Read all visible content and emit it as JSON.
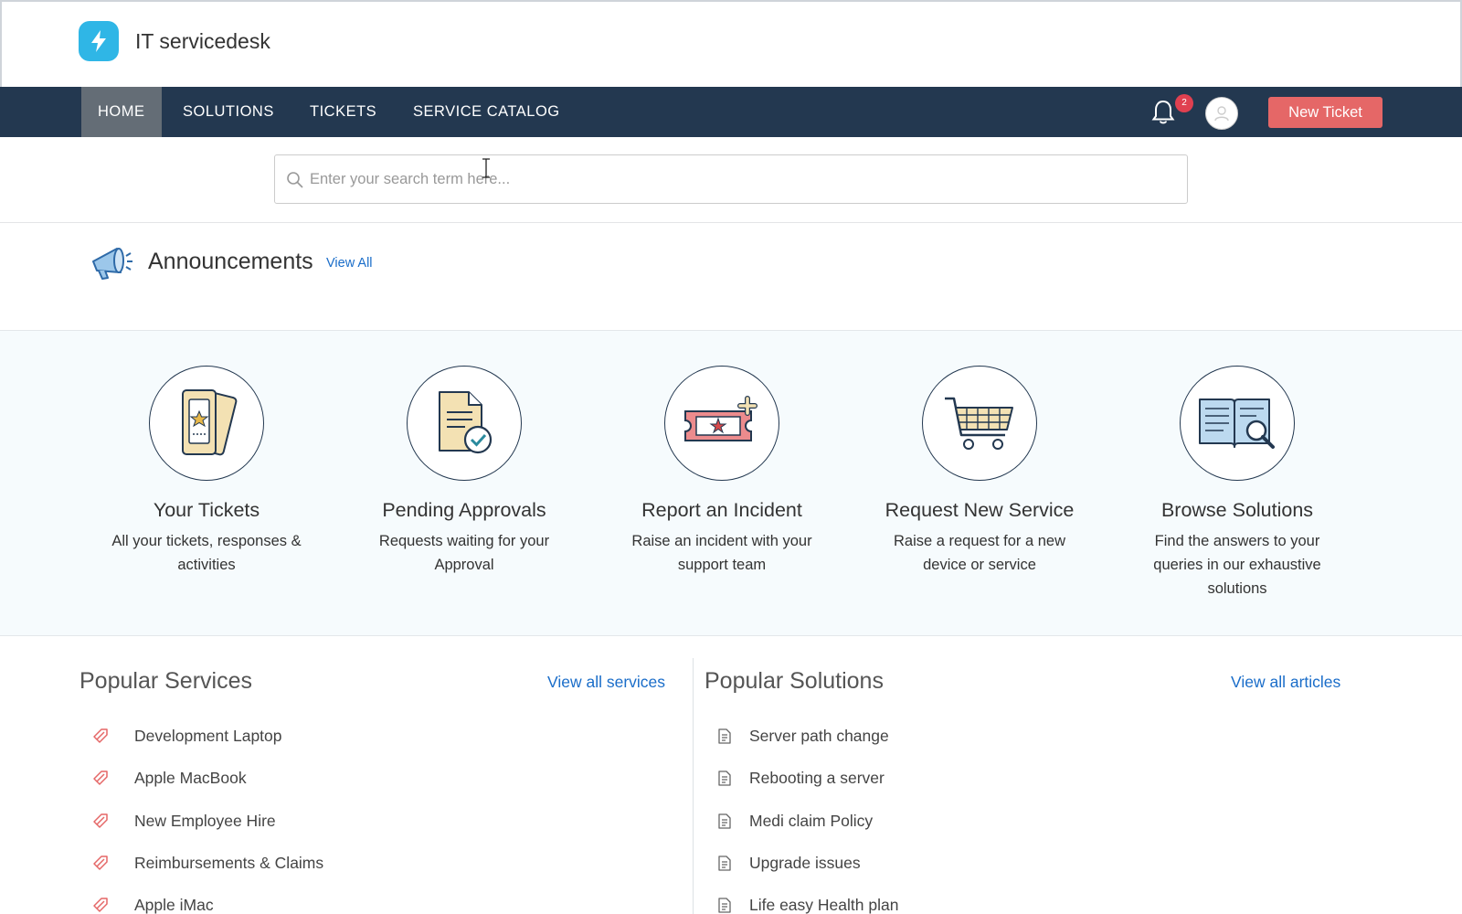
{
  "app": {
    "title": "IT servicedesk",
    "logo_icon": "lightning-bolt-icon"
  },
  "nav": {
    "items": [
      {
        "label": "HOME",
        "active": true
      },
      {
        "label": "SOLUTIONS",
        "active": false
      },
      {
        "label": "TICKETS",
        "active": false
      },
      {
        "label": "SERVICE CATALOG",
        "active": false
      }
    ],
    "notifications_count": "2",
    "new_ticket_label": "New Ticket"
  },
  "search": {
    "placeholder": "Enter your search term here...",
    "value": ""
  },
  "announcements": {
    "title": "Announcements",
    "view_all": "View All"
  },
  "quick_actions": [
    {
      "title": "Your Tickets",
      "desc": "All your tickets, responses & activities",
      "icon": "tickets-icon"
    },
    {
      "title": "Pending Approvals",
      "desc": "Requests waiting for your Approval",
      "icon": "approval-document-icon"
    },
    {
      "title": "Report an Incident",
      "desc": "Raise an incident with your support team",
      "icon": "report-incident-icon"
    },
    {
      "title": "Request New Service",
      "desc": "Raise a request for a new device or service",
      "icon": "shopping-cart-icon"
    },
    {
      "title": "Browse Solutions",
      "desc": "Find the answers to your queries in our exhaustive solutions",
      "icon": "book-search-icon"
    }
  ],
  "popular_services": {
    "title": "Popular Services",
    "view_all": "View all services",
    "items": [
      "Development Laptop",
      "Apple MacBook",
      "New Employee Hire",
      "Reimbursements & Claims",
      "Apple iMac"
    ]
  },
  "popular_solutions": {
    "title": "Popular Solutions",
    "view_all": "View all articles",
    "items": [
      "Server path change",
      "Rebooting a server",
      "Medi claim Policy",
      "Upgrade issues",
      "Life easy Health plan"
    ]
  },
  "colors": {
    "nav_bg": "#233850",
    "nav_active": "#646d76",
    "accent_button": "#e56767",
    "link": "#1a6dc9",
    "brand": "#2fb6e6",
    "badge": "#e04050"
  }
}
